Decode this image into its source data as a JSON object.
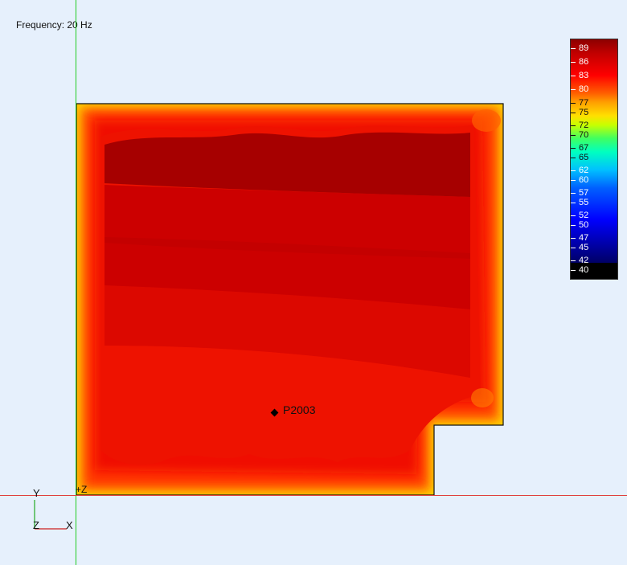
{
  "header": {
    "frequency_label": "Frequency: 20 Hz"
  },
  "probe": {
    "label": "P2003"
  },
  "legend": {
    "ticks": [
      "89",
      "86",
      "83",
      "80",
      "77",
      "75",
      "72",
      "70",
      "67",
      "65",
      "62",
      "60",
      "57",
      "55",
      "52",
      "50",
      "47",
      "45",
      "42",
      "40"
    ]
  },
  "triad": {
    "y_label": "Y",
    "z_label": "Z",
    "x_label": "X",
    "plus_z_label": "+Z"
  },
  "colors": {
    "background": "#e6f0fc",
    "axis_vertical": "#22cc22",
    "axis_horizontal": "#e04040",
    "band_darkest": "#a00000",
    "band_dark": "#c00000",
    "band_mid": "#dd0000",
    "band_red": "#f01000",
    "band_edge_orange": "#ff5000",
    "band_edge_yellow": "#ffd000"
  }
}
